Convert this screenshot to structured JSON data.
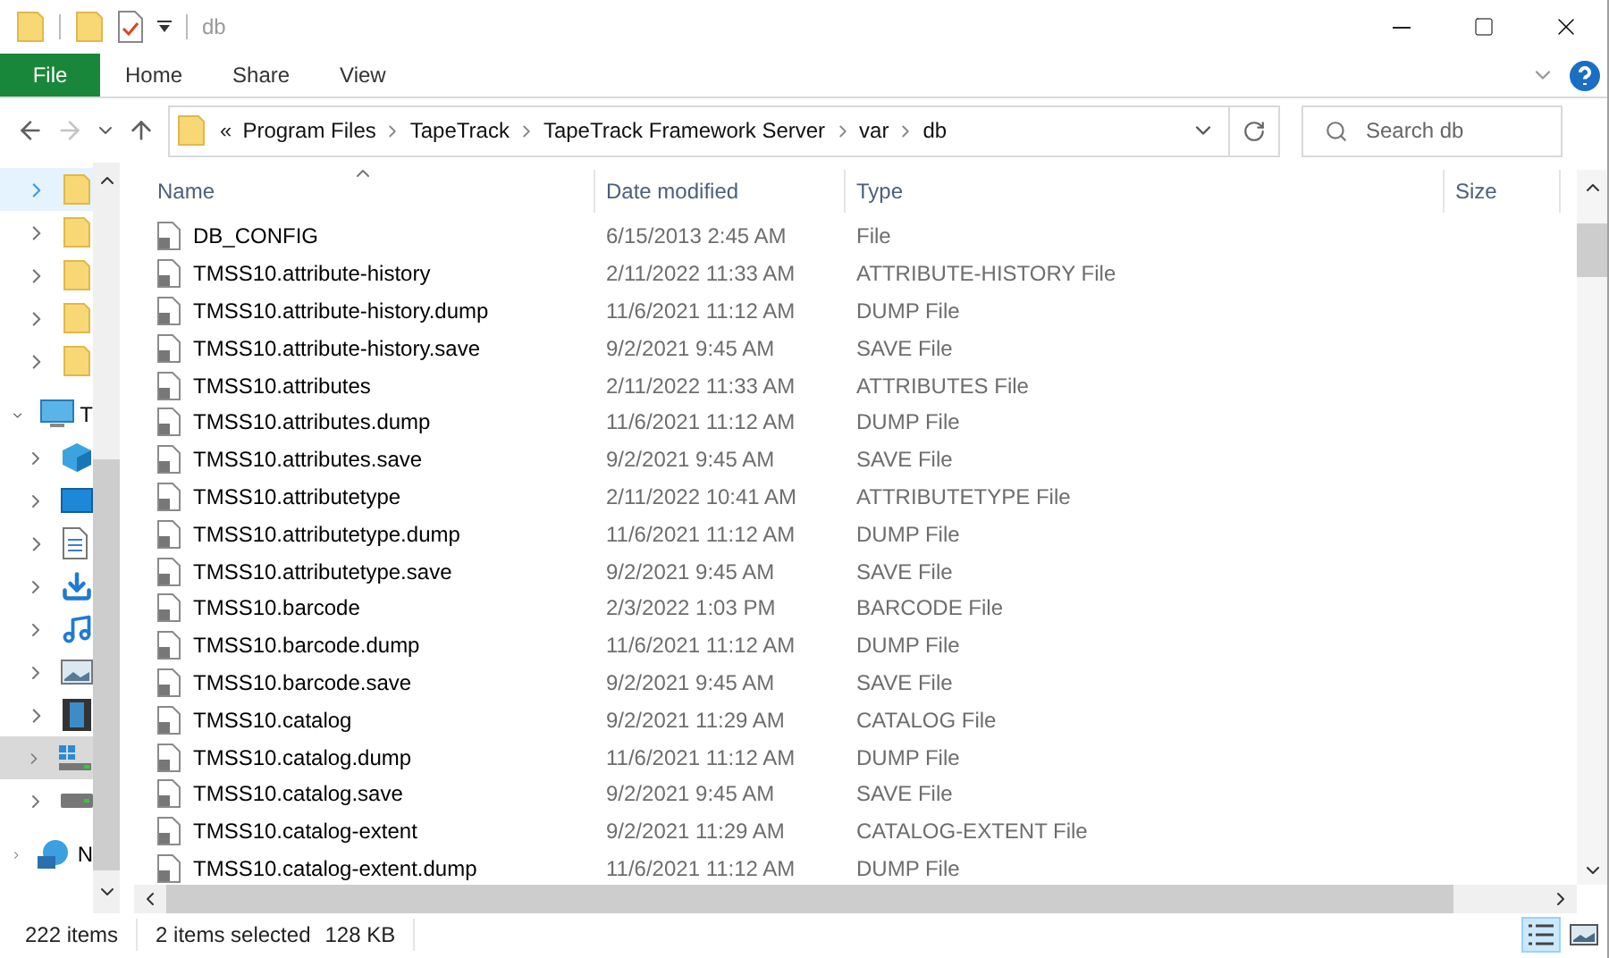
{
  "window": {
    "title": "db"
  },
  "ribbon": {
    "tabs": [
      {
        "label": "File",
        "kind": "file"
      },
      {
        "label": "Home",
        "kind": "tab"
      },
      {
        "label": "Share",
        "kind": "tab"
      },
      {
        "label": "View",
        "kind": "tab"
      }
    ]
  },
  "nav_buttons": [
    {
      "kind": "back",
      "disabled": false
    },
    {
      "kind": "forward",
      "disabled": true
    },
    {
      "kind": "recent",
      "disabled": false
    },
    {
      "kind": "up",
      "disabled": false
    }
  ],
  "address_bar": {
    "overflow": "«",
    "crumbs": [
      "Program Files",
      "TapeTrack",
      "TapeTrack Framework Server",
      "var",
      "db"
    ]
  },
  "search": {
    "placeholder": "Search db"
  },
  "nav_tree": [
    {
      "kind": "folder",
      "hovered": true,
      "selected": false,
      "expanded": false
    },
    {
      "kind": "folder",
      "hovered": false,
      "selected": false,
      "expanded": false
    },
    {
      "kind": "folder",
      "hovered": false,
      "selected": false,
      "expanded": false
    },
    {
      "kind": "folder",
      "hovered": false,
      "selected": false,
      "expanded": false
    },
    {
      "kind": "folder",
      "hovered": false,
      "selected": false,
      "expanded": false
    },
    {
      "kind": "pc",
      "label": "T",
      "hovered": false,
      "selected": false,
      "expanded": true,
      "children": [
        {
          "kind": "objects3d",
          "hovered": false,
          "selected": false,
          "expanded": false
        },
        {
          "kind": "desktop",
          "hovered": false,
          "selected": false,
          "expanded": false
        },
        {
          "kind": "documents",
          "hovered": false,
          "selected": false,
          "expanded": false
        },
        {
          "kind": "downloads",
          "hovered": false,
          "selected": false,
          "expanded": false
        },
        {
          "kind": "music",
          "hovered": false,
          "selected": false,
          "expanded": false
        },
        {
          "kind": "pictures",
          "hovered": false,
          "selected": false,
          "expanded": false
        },
        {
          "kind": "videos",
          "hovered": false,
          "selected": false,
          "expanded": false
        },
        {
          "kind": "system-drive",
          "hovered": false,
          "selected": true,
          "expanded": false
        },
        {
          "kind": "drive",
          "hovered": false,
          "selected": false,
          "expanded": false
        }
      ]
    },
    {
      "kind": "network",
      "label": "N",
      "hovered": false,
      "selected": false,
      "expanded": false
    }
  ],
  "table": {
    "columns": [
      "Name",
      "Date modified",
      "Type",
      "Size"
    ],
    "rows": [
      {
        "name": "DB_CONFIG",
        "date": "6/15/2013 2:45 AM",
        "type": "File"
      },
      {
        "name": "TMSS10.attribute-history",
        "date": "2/11/2022 11:33 AM",
        "type": "ATTRIBUTE-HISTORY File"
      },
      {
        "name": "TMSS10.attribute-history.dump",
        "date": "11/6/2021 11:12 AM",
        "type": "DUMP File"
      },
      {
        "name": "TMSS10.attribute-history.save",
        "date": "9/2/2021 9:45 AM",
        "type": "SAVE File"
      },
      {
        "name": "TMSS10.attributes",
        "date": "2/11/2022 11:33 AM",
        "type": "ATTRIBUTES File"
      },
      {
        "name": "TMSS10.attributes.dump",
        "date": "11/6/2021 11:12 AM",
        "type": "DUMP File"
      },
      {
        "name": "TMSS10.attributes.save",
        "date": "9/2/2021 9:45 AM",
        "type": "SAVE File"
      },
      {
        "name": "TMSS10.attributetype",
        "date": "2/11/2022 10:41 AM",
        "type": "ATTRIBUTETYPE File"
      },
      {
        "name": "TMSS10.attributetype.dump",
        "date": "11/6/2021 11:12 AM",
        "type": "DUMP File"
      },
      {
        "name": "TMSS10.attributetype.save",
        "date": "9/2/2021 9:45 AM",
        "type": "SAVE File"
      },
      {
        "name": "TMSS10.barcode",
        "date": "2/3/2022 1:03 PM",
        "type": "BARCODE File"
      },
      {
        "name": "TMSS10.barcode.dump",
        "date": "11/6/2021 11:12 AM",
        "type": "DUMP File"
      },
      {
        "name": "TMSS10.barcode.save",
        "date": "9/2/2021 9:45 AM",
        "type": "SAVE File"
      },
      {
        "name": "TMSS10.catalog",
        "date": "9/2/2021 11:29 AM",
        "type": "CATALOG File"
      },
      {
        "name": "TMSS10.catalog.dump",
        "date": "11/6/2021 11:12 AM",
        "type": "DUMP File"
      },
      {
        "name": "TMSS10.catalog.save",
        "date": "9/2/2021 9:45 AM",
        "type": "SAVE File"
      },
      {
        "name": "TMSS10.catalog-extent",
        "date": "9/2/2021 11:29 AM",
        "type": "CATALOG-EXTENT File"
      },
      {
        "name": "TMSS10.catalog-extent.dump",
        "date": "11/6/2021 11:12 AM",
        "type": "DUMP File"
      }
    ]
  },
  "status_bar": {
    "item_count": "222 items",
    "selection": "2 items selected",
    "selection_size": "128 KB"
  },
  "view_buttons": [
    {
      "kind": "details",
      "selected": true
    },
    {
      "kind": "large-icons",
      "selected": false
    }
  ]
}
